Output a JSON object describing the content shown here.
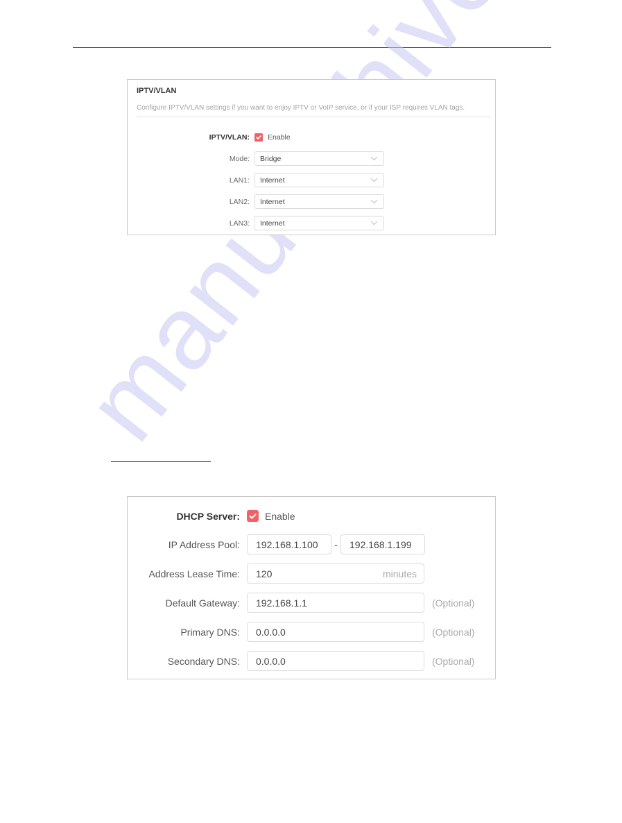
{
  "watermark": "manualshive.com",
  "iptv_panel": {
    "title": "IPTV/VLAN",
    "description": "Configure IPTV/VLAN settings if you want to enjoy IPTV or VoIP service, or if your ISP requires VLAN tags.",
    "enable_label": "IPTV/VLAN:",
    "enable_checkbox_label": "Enable",
    "enable_checked": true,
    "fields": [
      {
        "label": "Mode:",
        "value": "Bridge"
      },
      {
        "label": "LAN1:",
        "value": "Internet"
      },
      {
        "label": "LAN2:",
        "value": "Internet"
      },
      {
        "label": "LAN3:",
        "value": "Internet"
      }
    ]
  },
  "dhcp_panel": {
    "enable_label": "DHCP Server:",
    "enable_checkbox_label": "Enable",
    "enable_checked": true,
    "ip_pool": {
      "label": "IP Address Pool:",
      "start": "192.168.1.100",
      "separator": "-",
      "end": "192.168.1.199"
    },
    "lease_time": {
      "label": "Address Lease Time:",
      "value": "120",
      "unit": "minutes"
    },
    "default_gateway": {
      "label": "Default Gateway:",
      "value": "192.168.1.1",
      "hint": "(Optional)"
    },
    "primary_dns": {
      "label": "Primary DNS:",
      "value": "0.0.0.0",
      "hint": "(Optional)"
    },
    "secondary_dns": {
      "label": "Secondary DNS:",
      "value": "0.0.0.0",
      "hint": "(Optional)"
    }
  },
  "colors": {
    "checkbox_accent": "#f16168",
    "panel_border": "#c9c9c9",
    "hint_text": "#aaaaaa"
  }
}
